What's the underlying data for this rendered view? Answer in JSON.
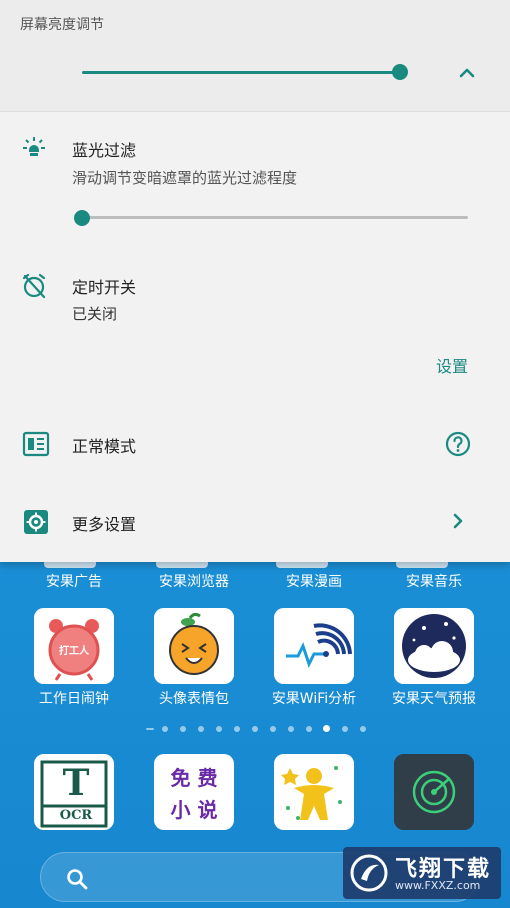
{
  "quick_panel": {
    "brightness": {
      "title": "屏幕亮度调节",
      "level": 0.97,
      "icon": "moon-icon",
      "collapse_icon": "chevron-up-icon"
    },
    "blue_filter": {
      "title": "蓝光过滤",
      "subtitle": "滑动调节变暗遮罩的蓝光过滤程度",
      "level": 0.0,
      "icon": "bulb-icon"
    },
    "timer": {
      "title": "定时开关",
      "status": "已关闭",
      "action_label": "设置",
      "icon": "alarm-off-icon"
    },
    "mode": {
      "title": "正常模式",
      "icon": "grid-mode-icon",
      "help_icon": "help-icon"
    },
    "more": {
      "title": "更多设置",
      "icon": "settings-gear-icon",
      "arrow_icon": "chevron-right-icon"
    },
    "accent_color": "#1a8a80"
  },
  "home": {
    "top_labels": [
      "安果广告",
      "安果浏览器",
      "安果漫画",
      "安果音乐"
    ],
    "apps_row1": [
      {
        "name": "工作日闹钟",
        "icon_text": "打工人"
      },
      {
        "name": "头像表情包"
      },
      {
        "name": "安果WiFi分析"
      },
      {
        "name": "安果天气预报"
      }
    ],
    "apps_row2": [
      {
        "icon_text_top": "T",
        "icon_text_bottom": "OCR"
      },
      {
        "icon_text_1": "免 费",
        "icon_text_2": "小 说"
      },
      {},
      {}
    ],
    "page_indicator": {
      "pages": 12,
      "active": 10
    },
    "search_icon": "search-icon",
    "background_color": "#1a8fd6"
  },
  "watermark": {
    "brand": "飞翔下载",
    "url": "www.FXXZ.com"
  }
}
